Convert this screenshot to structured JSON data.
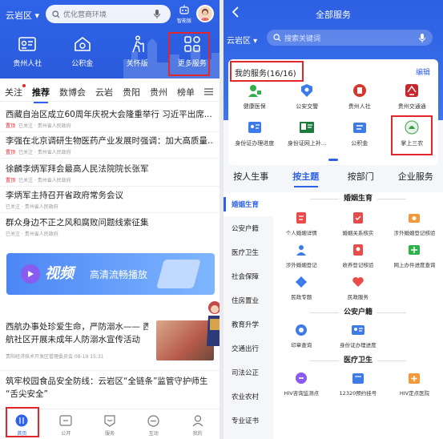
{
  "left": {
    "region": "云岩区",
    "search_placeholder": "优化营商环境",
    "smart_label": "智能版",
    "quick": [
      {
        "label": "贵州人社",
        "icon": "id-card-icon"
      },
      {
        "label": "公积金",
        "icon": "house-fund-icon"
      },
      {
        "label": "关怀版",
        "icon": "elder-care-icon"
      },
      {
        "label": "更多服务",
        "icon": "grid-more-icon"
      }
    ],
    "tabs": [
      "关注",
      "推荐",
      "数博会",
      "云岩",
      "贵阳",
      "贵州",
      "榜单"
    ],
    "active_tab": "推荐",
    "news": [
      {
        "title": "西藏自治区成立60周年庆祝大会隆重举行 习近平出席...",
        "tag": "置顶",
        "meta": "已关注 · 贵州省人民政府"
      },
      {
        "title": "李强在北京调研生物医药产业发展时强调：加大高质量...",
        "tag": "置顶",
        "meta": "已关注 · 贵州省人民政府"
      },
      {
        "title": "徐麟李炳军拜会最高人民法院院长张军",
        "tag": "置顶",
        "meta": "已关注 · 贵州省人民政府"
      },
      {
        "title": "李炳军主持召开省政府常务会议",
        "tag": "",
        "meta": "已关注 · 贵州省人民政府"
      },
      {
        "title": "群众身边不正之风和腐败问题线索征集",
        "tag": "",
        "meta": "已关注 · 贵州省人民政府"
      }
    ],
    "banner": {
      "title": "视频",
      "subtitle": "高清流畅播放"
    },
    "news2": {
      "title_line1": "西航办事处珍爱生命，严防溺水—— 西",
      "title_line2": "航社区开展未成年人防溺水宣传活动",
      "meta": "贵阳经济技术开发区管理委员会    08-19 15:31"
    },
    "news3": {
      "title_line1": "筑牢校园食品安全防线：云岩区“全链条”监管守护师生",
      "title_line2": "“舌尖安全”"
    },
    "bottom_nav": [
      {
        "label": "首页",
        "icon": "home-icon",
        "active": true
      },
      {
        "label": "公开",
        "icon": "folder-icon",
        "active": false
      },
      {
        "label": "服务",
        "icon": "service-icon",
        "active": false
      },
      {
        "label": "互动",
        "icon": "chat-icon",
        "active": false
      },
      {
        "label": "我的",
        "icon": "user-icon",
        "active": false
      }
    ]
  },
  "right": {
    "title": "全部服务",
    "region": "云岩区",
    "search_placeholder": "搜索关键词",
    "my_services_title": "我的服务(16/16)",
    "edit_label": "编辑",
    "my_services": [
      {
        "label": "健康医保",
        "color": "#2fb24a"
      },
      {
        "label": "公安交警",
        "color": "#3d7be8"
      },
      {
        "label": "贵州人社",
        "color": "#d6362c"
      },
      {
        "label": "贵州交通通",
        "color": "#c8262a"
      },
      {
        "label": "身份证办理进度",
        "color": "#3d7be8"
      },
      {
        "label": "身份证网上补...",
        "color": "#1f7a3e"
      },
      {
        "label": "公积金",
        "color": "#3d7be8"
      },
      {
        "label": "掌上三农",
        "color": "#3aa14a"
      }
    ],
    "cat_tabs": [
      "按人生事",
      "按主题",
      "按部门",
      "企业服务"
    ],
    "active_cat": "按主题",
    "side": [
      "婚姻生育",
      "公安户籍",
      "医疗卫生",
      "社会保障",
      "住房置业",
      "教育升学",
      "交通出行",
      "司法公正",
      "农业农村",
      "专业证书"
    ],
    "active_side": "婚姻生育",
    "sections": [
      {
        "title": "婚姻生育",
        "items": [
          {
            "label": "个人婚姻详情",
            "color": "#e94b4b"
          },
          {
            "label": "婚姻关系核实",
            "color": "#e94b4b"
          },
          {
            "label": "涉外婚姻登记核验",
            "color": "#f29a3a"
          },
          {
            "label": "涉外婚姻登记",
            "color": "#3d7be8"
          },
          {
            "label": "收养登记核验",
            "color": "#e94b4b"
          },
          {
            "label": "网上办件进度查询",
            "color": "#2fb24a"
          },
          {
            "label": "民政专题",
            "color": "#3d7be8"
          },
          {
            "label": "民政服务",
            "color": "#e94b4b"
          }
        ]
      },
      {
        "title": "公安户籍",
        "items": [
          {
            "label": "印章查询",
            "color": "#3d7be8"
          },
          {
            "label": "身份证办理进度",
            "color": "#3d7be8"
          }
        ]
      },
      {
        "title": "医疗卫生",
        "items": [
          {
            "label": "HIV咨询监测点",
            "color": "#8a5bf0"
          },
          {
            "label": "12320预约挂号",
            "color": "#3d7be8"
          },
          {
            "label": "HIV定点医院",
            "color": "#f29a3a"
          }
        ]
      }
    ]
  }
}
